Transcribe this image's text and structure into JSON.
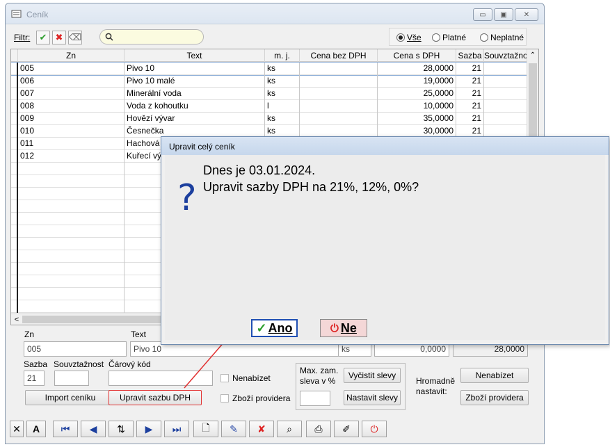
{
  "window": {
    "title": "Ceník"
  },
  "filter": {
    "label": "Filtr:",
    "search_placeholder": "",
    "radios": [
      {
        "label": "Vše",
        "selected": true
      },
      {
        "label": "Platné",
        "selected": false
      },
      {
        "label": "Neplatné",
        "selected": false
      }
    ]
  },
  "grid": {
    "columns": [
      "Zn",
      "Text",
      "m. j.",
      "Cena bez DPH",
      "Cena s DPH",
      "Sazba",
      "Souvztažno"
    ],
    "rows": [
      {
        "zn": "005",
        "text": "Pivo 10",
        "mj": "ks",
        "bez": "",
        "s": "28,0000",
        "sazba": "21"
      },
      {
        "zn": "006",
        "text": "Pivo 10 malé",
        "mj": "ks",
        "bez": "",
        "s": "19,0000",
        "sazba": "21"
      },
      {
        "zn": "007",
        "text": "Minerální voda",
        "mj": "ks",
        "bez": "",
        "s": "25,0000",
        "sazba": "21"
      },
      {
        "zn": "008",
        "text": "Voda z kohoutku",
        "mj": "l",
        "bez": "",
        "s": "10,0000",
        "sazba": "21"
      },
      {
        "zn": "009",
        "text": "Hovězí vývar",
        "mj": "ks",
        "bez": "",
        "s": "35,0000",
        "sazba": "21"
      },
      {
        "zn": "010",
        "text": "Česnečka",
        "mj": "ks",
        "bez": "",
        "s": "30,0000",
        "sazba": "21"
      },
      {
        "zn": "011",
        "text": "Hachová",
        "mj": "",
        "bez": "",
        "s": "",
        "sazba": ""
      },
      {
        "zn": "012",
        "text": "Kuřecí vý",
        "mj": "",
        "bez": "",
        "s": "",
        "sazba": ""
      }
    ]
  },
  "detail": {
    "zn_label": "Zn",
    "zn_value": "005",
    "text_label": "Text",
    "text_value": "Pivo 10",
    "mj_value": "ks",
    "bez_value": "0,0000",
    "s_value": "28,0000",
    "sazba_label": "Sazba",
    "sazba_value": "21",
    "souvz_label": "Souvztažnost",
    "carovy_label": "Čárový kód",
    "nenabizet_label": "Nenabízet",
    "zbozi_providera_label": "Zboží providera",
    "max_zam_label": "Max. zam. sleva v %",
    "vycistit_label": "Vyčistit slevy",
    "nastavit_label": "Nastavit slevy",
    "hromadne_label": "Hromadně nastavit:",
    "hromadne_nenabizet": "Nenabízet",
    "hromadne_zbozi": "Zboží providera",
    "import_label": "Import ceníku",
    "upravit_label": "Upravit sazbu DPH"
  },
  "dialog": {
    "title": "Upravit celý ceník",
    "line1": "Dnes je 03.01.2024.",
    "line2": "Upravit sazby DPH na 21%, 12%, 0%?",
    "yes_label": "Ano",
    "no_label": "Ne"
  },
  "colors": {
    "highlight": "#e23030",
    "accent": "#1c3f9e"
  }
}
